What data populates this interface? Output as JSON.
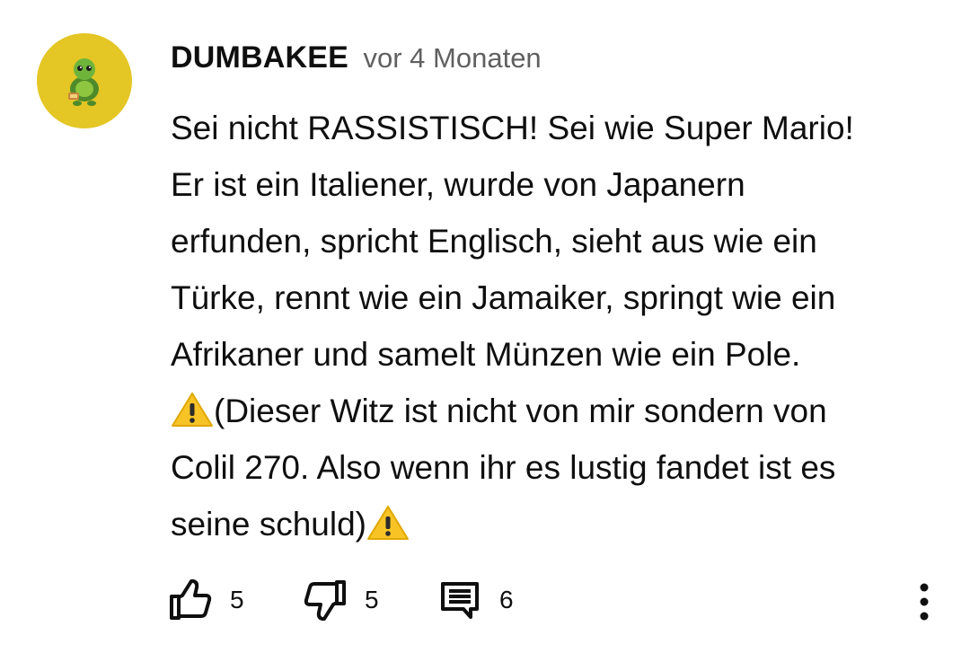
{
  "comment": {
    "author": "DUMBAKEE",
    "time": "vor 4 Monaten",
    "avatar": "turtle-avatar",
    "text_lines": [
      "Sei nicht RASSISTISCH! Sei wie Super Mario!",
      "Er ist ein Italiener, wurde von Japanern",
      "erfunden, spricht Englisch, sieht aus wie ein",
      "Türke, rennt wie ein Jamaiker, springt wie ein",
      "Afrikaner und samelt Münzen wie ein Pole."
    ],
    "note_text_1": "(Dieser Witz ist nicht von mir sondern von",
    "note_text_2": "Colil 270. Also wenn ihr es lustig fandet ist es",
    "note_text_3": "seine schuld)",
    "warning_icon": "warning-emoji"
  },
  "actions": {
    "likes": "5",
    "dislikes": "5",
    "replies": "6",
    "like_icon": "thumbs-up-icon",
    "dislike_icon": "thumbs-down-icon",
    "reply_icon": "comment-icon",
    "more_icon": "more-vertical-icon"
  },
  "colors": {
    "avatar_bg": "#e4c625",
    "text": "#0f0f0f",
    "secondary_text": "#606060",
    "warning": "#f7c325"
  }
}
